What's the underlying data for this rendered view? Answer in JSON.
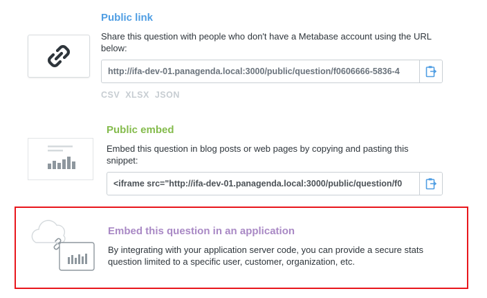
{
  "public_link": {
    "title": "Public link",
    "description": "Share this question with people who don't have a Metabase account using the URL below:",
    "url": "http://ifa-dev-01.panagenda.local:3000/public/question/f0606666-5836-4",
    "formats": [
      "CSV",
      "XLSX",
      "JSON"
    ],
    "icon": "link-icon",
    "copy_icon": "clipboard-icon",
    "accent": "#509ee3"
  },
  "public_embed": {
    "title": "Public embed",
    "description": "Embed this question in blog posts or web pages by copying and pasting this snippet:",
    "snippet": "<iframe   src=\"http://ifa-dev-01.panagenda.local:3000/public/question/f0",
    "copy_icon": "clipboard-icon",
    "accent": "#84bb4c"
  },
  "app_embed": {
    "title": "Embed this question in an application",
    "description": "By integrating with your application server code, you can provide a secure stats question limited to a specific user, customer, organization, etc.",
    "accent": "#a989c5",
    "highlight_color": "#e8151b"
  }
}
